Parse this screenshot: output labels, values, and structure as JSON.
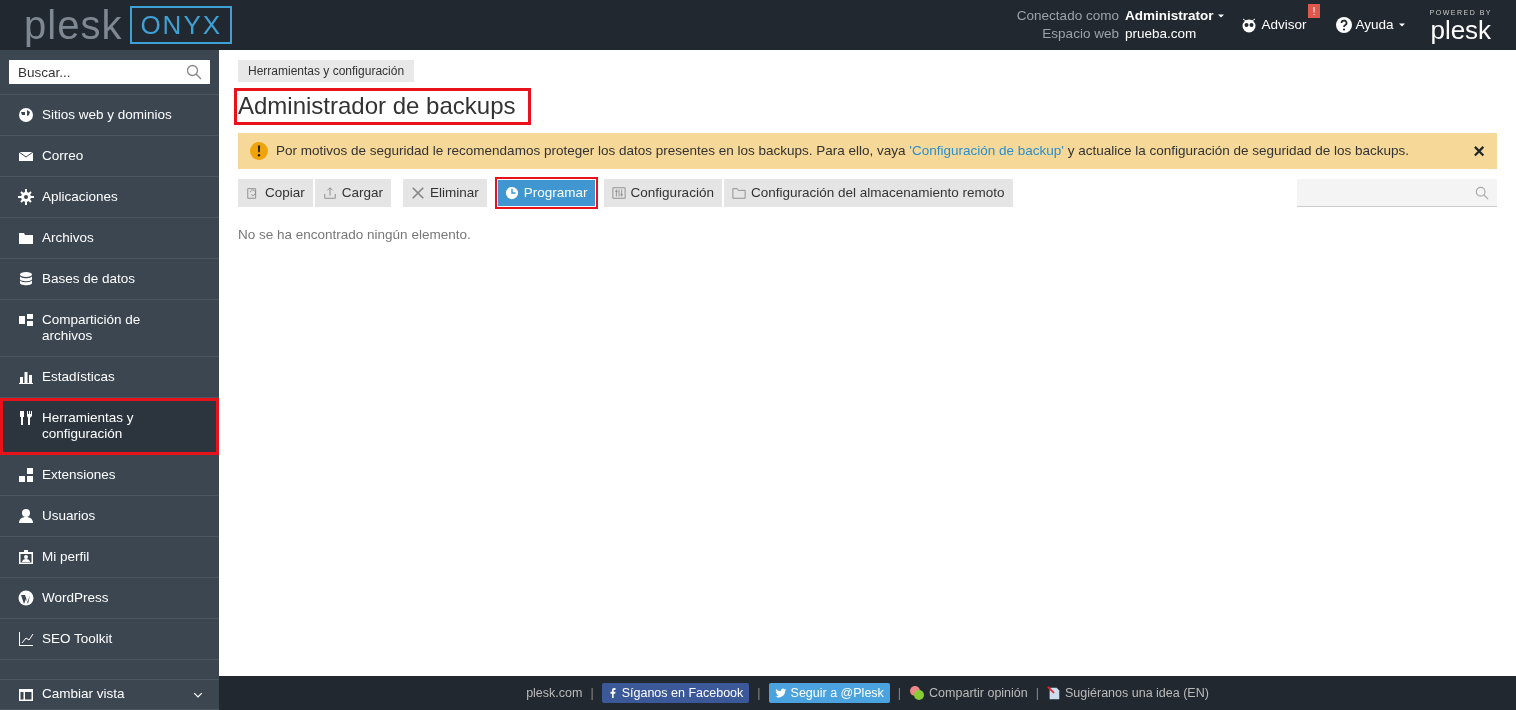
{
  "header": {
    "logo": {
      "brand": "plesk",
      "edition": "ONYX"
    },
    "account": {
      "user_label": "Conectado como",
      "user": "Administrator",
      "space_label": "Espacio web",
      "space": "prueba.com"
    },
    "advisor": {
      "label": "Advisor",
      "alert": "!"
    },
    "help": {
      "label": "Ayuda"
    },
    "powered": {
      "caption": "POWERED BY",
      "brand": "plesk"
    }
  },
  "sidebar": {
    "search": {
      "placeholder": "Buscar..."
    },
    "items": [
      {
        "label": "Sitios web y dominios",
        "selected": false,
        "highlighted": false
      },
      {
        "label": "Correo",
        "selected": false,
        "highlighted": false
      },
      {
        "label": "Aplicaciones",
        "selected": false,
        "highlighted": false
      },
      {
        "label": "Archivos",
        "selected": false,
        "highlighted": false
      },
      {
        "label": "Bases de datos",
        "selected": false,
        "highlighted": false
      },
      {
        "label": "Compartición de archivos",
        "selected": false,
        "highlighted": false
      },
      {
        "label": "Estadísticas",
        "selected": false,
        "highlighted": false
      },
      {
        "label": "Herramientas y configuración",
        "selected": true,
        "highlighted": true
      },
      {
        "label": "Extensiones",
        "selected": false,
        "highlighted": false
      },
      {
        "label": "Usuarios",
        "selected": false,
        "highlighted": false
      },
      {
        "label": "Mi perfil",
        "selected": false,
        "highlighted": false
      },
      {
        "label": "WordPress",
        "selected": false,
        "highlighted": false
      },
      {
        "label": "SEO Toolkit",
        "selected": false,
        "highlighted": false
      }
    ],
    "view_switch": {
      "label": "Cambiar vista",
      "expanded": false
    }
  },
  "breadcrumb": [
    "Herramientas y configuración"
  ],
  "title": {
    "text": "Administrador de backups",
    "highlighted": true
  },
  "alert": {
    "before": "Por motivos de seguridad le recomendamos proteger los datos presentes en los backups. Para ello, vaya ",
    "link": "'Configuración de backup'",
    "after": " y actualice la configuración de seguridad de los backups.",
    "close": "×"
  },
  "toolbar": [
    {
      "label": "Copiar",
      "kind": "default",
      "highlighted": false
    },
    {
      "label": "Cargar",
      "kind": "default",
      "highlighted": false
    },
    {
      "label": "Eliminar",
      "kind": "default",
      "highlighted": false
    },
    {
      "label": "Programar",
      "kind": "primary",
      "highlighted": true
    },
    {
      "label": "Configuración",
      "kind": "default",
      "highlighted": false
    },
    {
      "label": "Configuración del almacenamiento remoto",
      "kind": "default",
      "highlighted": false
    }
  ],
  "empty_message": "No se ha encontrado ningún elemento.",
  "footer": [
    {
      "label": "plesk.com",
      "kind": "link"
    },
    {
      "label": "|",
      "kind": "separator"
    },
    {
      "label": "Síganos en Facebook",
      "kind": "facebook"
    },
    {
      "label": "|",
      "kind": "separator"
    },
    {
      "label": "Seguir a @Plesk",
      "kind": "twitter"
    },
    {
      "label": "|",
      "kind": "separator"
    },
    {
      "label": "Compartir opinión",
      "kind": "feedback"
    },
    {
      "label": "|",
      "kind": "separator"
    },
    {
      "label": "Sugiéranos una idea (EN)",
      "kind": "idea"
    }
  ]
}
